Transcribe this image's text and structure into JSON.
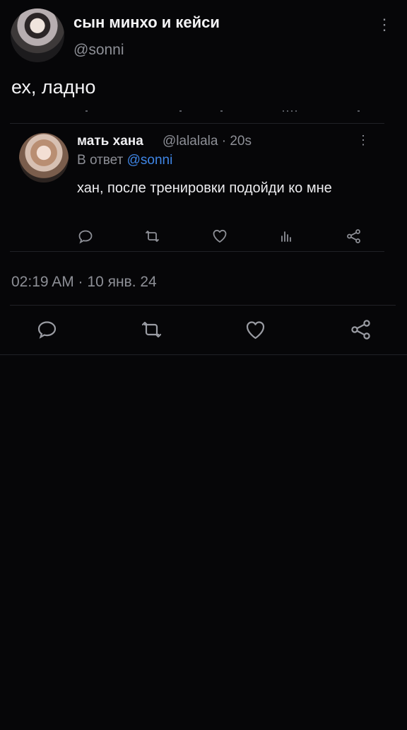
{
  "main_tweet": {
    "display_name": "сын минхо и кейси",
    "handle": "@sonni",
    "text": "ех, ладно",
    "timestamp": "02:19 AM · 10 янв. 24",
    "more_icon": "vertical-dots-icon"
  },
  "reply": {
    "display_name": "мать хана",
    "meta": "@lalalala · 20s",
    "reply_prefix": "В ответ",
    "reply_target": "@sonni",
    "text": "хан, после тренировки подойди ко мне",
    "actions": [
      "reply-icon",
      "retweet-icon",
      "like-icon",
      "views-icon",
      "share-icon"
    ]
  },
  "bottom_actions": [
    "reply-icon",
    "retweet-icon",
    "like-icon",
    "share-icon"
  ],
  "colors": {
    "background": "#060608",
    "text": "#f2f2f4",
    "secondary": "#8d8f96",
    "link": "#3f86e6",
    "divider": "#202126"
  }
}
